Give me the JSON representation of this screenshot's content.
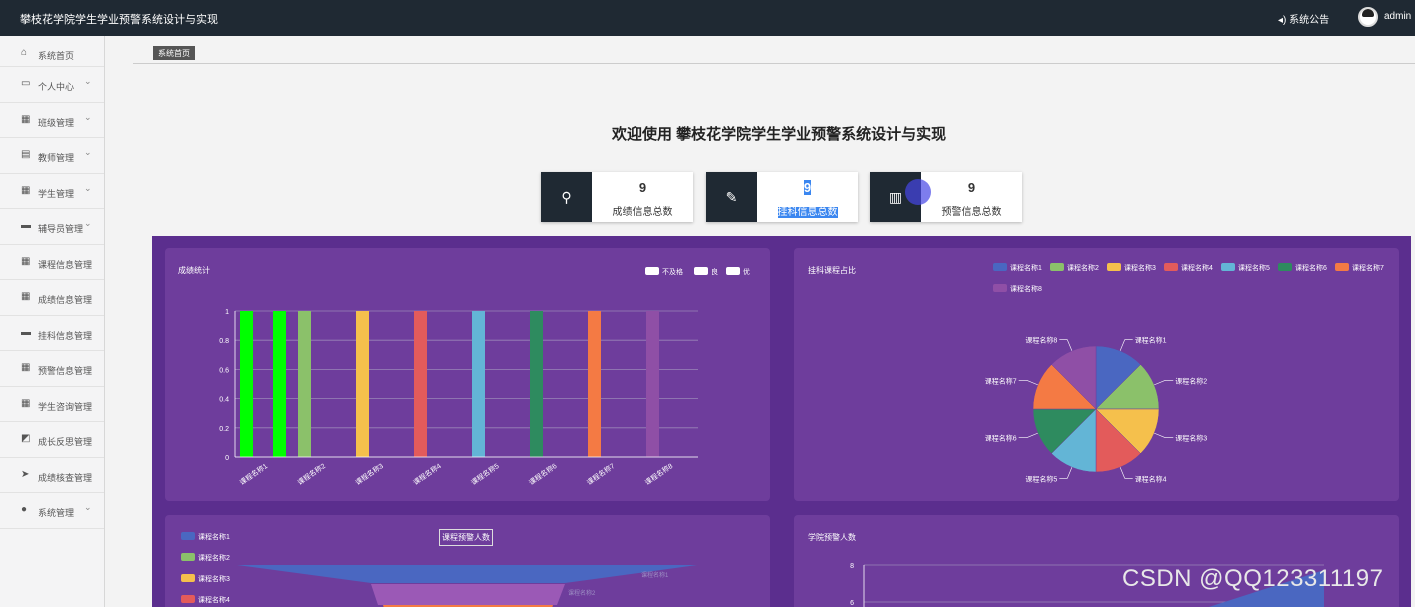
{
  "header": {
    "title": "攀枝花学院学生学业预警系统设计与实现",
    "notice_label": "系统公告",
    "user": "admin"
  },
  "sidebar": {
    "items": [
      {
        "label": "系统首页",
        "icon": "home-icon",
        "glyph": "⌂",
        "expandable": false
      },
      {
        "label": "个人中心",
        "icon": "profile-icon",
        "glyph": "▭",
        "expandable": true
      },
      {
        "label": "班级管理",
        "icon": "grid-icon",
        "glyph": "▦",
        "expandable": true
      },
      {
        "label": "教师管理",
        "icon": "clipboard-icon",
        "glyph": "▤",
        "expandable": true
      },
      {
        "label": "学生管理",
        "icon": "grid-icon",
        "glyph": "▦",
        "expandable": true
      },
      {
        "label": "辅导员管理",
        "icon": "monitor-icon",
        "glyph": "▬",
        "expandable": true
      },
      {
        "label": "课程信息管理",
        "icon": "grid-icon",
        "glyph": "▦",
        "expandable": false
      },
      {
        "label": "成绩信息管理",
        "icon": "grid-icon",
        "glyph": "▦",
        "expandable": false
      },
      {
        "label": "挂科信息管理",
        "icon": "monitor-icon",
        "glyph": "▬",
        "expandable": false
      },
      {
        "label": "预警信息管理",
        "icon": "grid-icon",
        "glyph": "▦",
        "expandable": false
      },
      {
        "label": "学生咨询管理",
        "icon": "grid-icon",
        "glyph": "▦",
        "expandable": false
      },
      {
        "label": "成长反思管理",
        "icon": "chart-icon",
        "glyph": "◩",
        "expandable": false
      },
      {
        "label": "成绩核查管理",
        "icon": "send-icon",
        "glyph": "➤",
        "expandable": false
      },
      {
        "label": "系统管理",
        "icon": "user-icon",
        "glyph": "●",
        "expandable": true
      }
    ]
  },
  "breadcrumb": "系统首页",
  "welcome": "欢迎使用 攀枝花学院学生学业预警系统设计与实现",
  "stats": [
    {
      "value": "9",
      "label": "成绩信息总数",
      "icon": "stamp-icon"
    },
    {
      "value": "9",
      "label": "挂科信息总数",
      "icon": "edit-icon",
      "selected": true
    },
    {
      "value": "9",
      "label": "预警信息总数",
      "icon": "bar-chart-icon"
    }
  ],
  "colors": {
    "topbar": "#1f2933",
    "dashboard_bg": "#5b2e8e",
    "panel_bg": "#6e3d9c",
    "palette": [
      "#4a67c1",
      "#8bc16a",
      "#f5c04c",
      "#e35b5b",
      "#63b5d6",
      "#2e8b5f",
      "#f47a44",
      "#8f4fa6"
    ]
  },
  "chart_data": [
    {
      "type": "bar",
      "title": "成绩统计",
      "legend": [
        "不及格",
        "良",
        "优"
      ],
      "categories": [
        "课程名称1",
        "课程名称2",
        "课程名称3",
        "课程名称4",
        "课程名称5",
        "课程名称6",
        "课程名称7",
        "课程名称8"
      ],
      "bars": [
        {
          "category": "课程名称1",
          "value": 1,
          "color": "#00ff00"
        },
        {
          "category": "课程名称1",
          "value": 1,
          "color": "#00ff00"
        },
        {
          "category": "课程名称2",
          "value": 1,
          "color": "#8bc16a"
        },
        {
          "category": "课程名称3",
          "value": 1,
          "color": "#f5c04c"
        },
        {
          "category": "课程名称4",
          "value": 1,
          "color": "#e35b5b"
        },
        {
          "category": "课程名称5",
          "value": 1,
          "color": "#63b5d6"
        },
        {
          "category": "课程名称6",
          "value": 1,
          "color": "#2e8b5f"
        },
        {
          "category": "课程名称7",
          "value": 1,
          "color": "#f47a44"
        },
        {
          "category": "课程名称8",
          "value": 1,
          "color": "#8f4fa6"
        }
      ],
      "yticks": [
        "0",
        "0.2",
        "0.4",
        "0.6",
        "0.8",
        "1"
      ],
      "ylim": [
        0,
        1
      ],
      "grid": true,
      "legend_position": "top-right"
    },
    {
      "type": "pie",
      "title": "挂科课程占比",
      "labels": [
        "课程名称1",
        "课程名称2",
        "课程名称3",
        "课程名称4",
        "课程名称5",
        "课程名称6",
        "课程名称7",
        "课程名称8"
      ],
      "values": [
        1,
        1,
        1,
        1,
        1,
        1,
        1,
        1
      ],
      "legend_position": "top-right"
    },
    {
      "type": "funnel",
      "title": "课程预警人数",
      "legend": [
        "课程名称1",
        "课程名称2",
        "课程名称3",
        "课程名称4"
      ],
      "labels": [
        "课程名称1",
        "课程名称2"
      ],
      "legend_position": "top-left"
    },
    {
      "type": "area",
      "title": "学院预警人数",
      "yticks": [
        "8",
        "6"
      ]
    }
  ],
  "watermark": "CSDN @QQ123311197"
}
